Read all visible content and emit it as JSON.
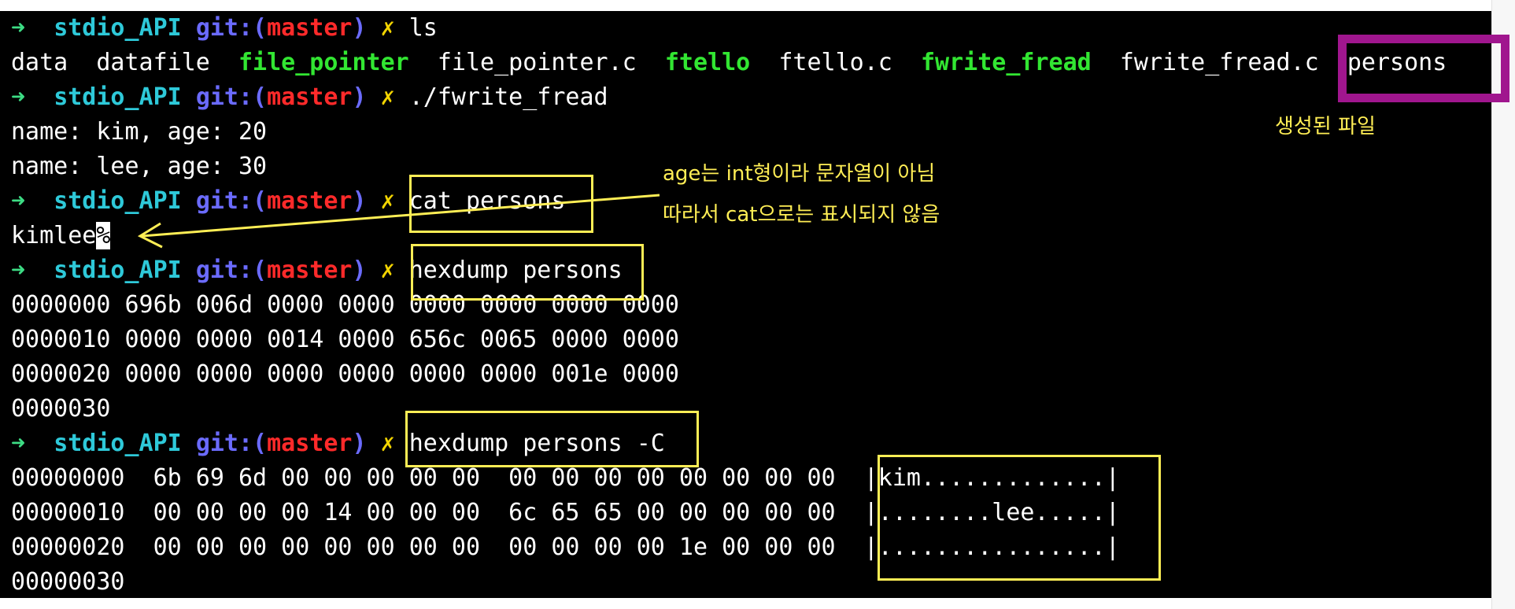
{
  "prompt": {
    "arrow": "➜",
    "dir": "stdio_API",
    "git": "git:(",
    "branch": "master",
    "git_close": ")",
    "dirty": "✗"
  },
  "lines": {
    "l1_cmd": "ls",
    "l2": [
      "data",
      "datafile",
      "file_pointer",
      "file_pointer.c",
      "ftello",
      "ftello.c",
      "fwrite_fread",
      "fwrite_fread.c",
      "persons"
    ],
    "l3_cmd": "./fwrite_fread",
    "l4": "name: kim, age: 20",
    "l5": "name: lee, age: 30",
    "l6_cmd": "cat persons",
    "l7_text": "kimlee",
    "l7_cursor": "%",
    "l8_cmd": "hexdump persons",
    "hex": [
      "0000000 696b 006d 0000 0000 0000 0000 0000 0000",
      "0000010 0000 0000 0014 0000 656c 0065 0000 0000",
      "0000020 0000 0000 0000 0000 0000 0000 001e 0000",
      "0000030"
    ],
    "l13_cmd": "hexdump persons -C",
    "hexc": [
      {
        "offset": "00000000",
        "bytes": "6b 69 6d 00 00 00 00 00  00 00 00 00 00 00 00 00",
        "ascii": "|kim.............|"
      },
      {
        "offset": "00000010",
        "bytes": "00 00 00 00 14 00 00 00  6c 65 65 00 00 00 00 00",
        "ascii": "|........lee.....|"
      },
      {
        "offset": "00000020",
        "bytes": "00 00 00 00 00 00 00 00  00 00 00 00 1e 00 00 00",
        "ascii": "|................|"
      }
    ],
    "hexc_end": "00000030"
  },
  "annotations": {
    "created_file": "생성된 파일",
    "note_line1": "age는 int형이라 문자열이 아님",
    "note_line2": "따라서 cat으로는 표시되지 않음"
  },
  "colors": {
    "background": "#000000",
    "prompt_arrow": "#3ddc84",
    "dir": "#2ec9d9",
    "git": "#6b6bff",
    "branch": "#ff2a2a",
    "dirty_mark": "#f2d400",
    "executable": "#32e632",
    "annotation": "#ffee55",
    "highlight_box": "#a0168e"
  }
}
